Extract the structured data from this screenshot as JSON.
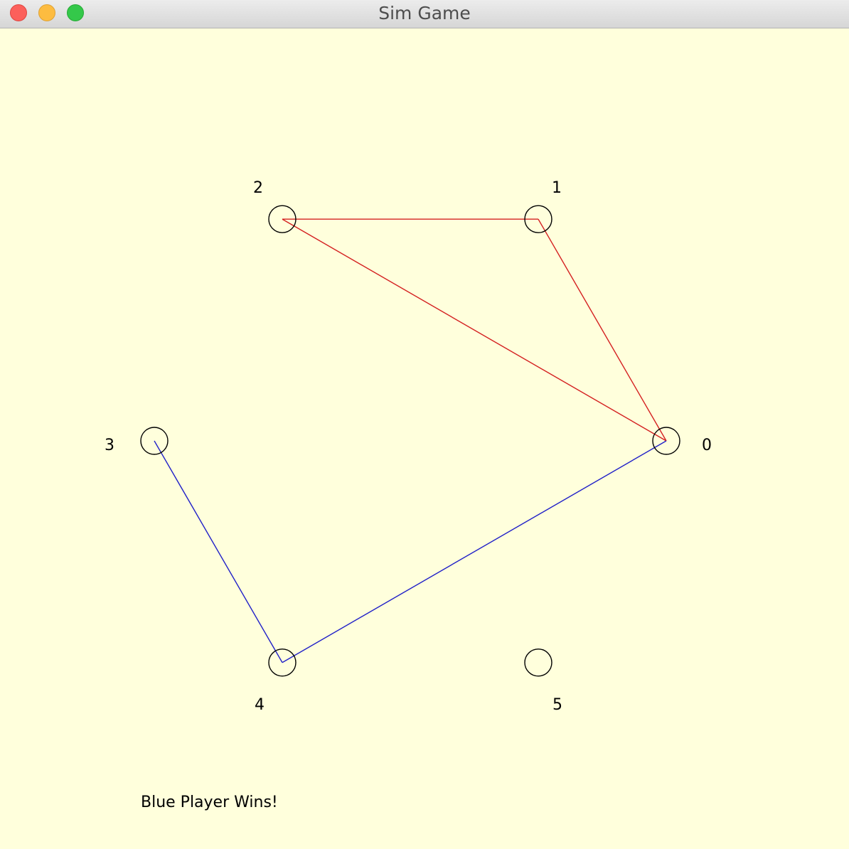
{
  "window": {
    "title": "Sim Game"
  },
  "colors": {
    "background": "#ffffdc",
    "red": "#d42020",
    "blue": "#2020c8",
    "vertex_stroke": "#000000"
  },
  "graph": {
    "vertices": [
      {
        "id": 0,
        "label": "0"
      },
      {
        "id": 1,
        "label": "1"
      },
      {
        "id": 2,
        "label": "2"
      },
      {
        "id": 3,
        "label": "3"
      },
      {
        "id": 4,
        "label": "4"
      },
      {
        "id": 5,
        "label": "5"
      }
    ],
    "edges": [
      {
        "from": 2,
        "to": 1,
        "player": "red"
      },
      {
        "from": 1,
        "to": 0,
        "player": "red"
      },
      {
        "from": 2,
        "to": 0,
        "player": "red"
      },
      {
        "from": 3,
        "to": 4,
        "player": "blue"
      },
      {
        "from": 4,
        "to": 0,
        "player": "blue"
      }
    ]
  },
  "status": {
    "message": "Blue Player Wins!"
  }
}
